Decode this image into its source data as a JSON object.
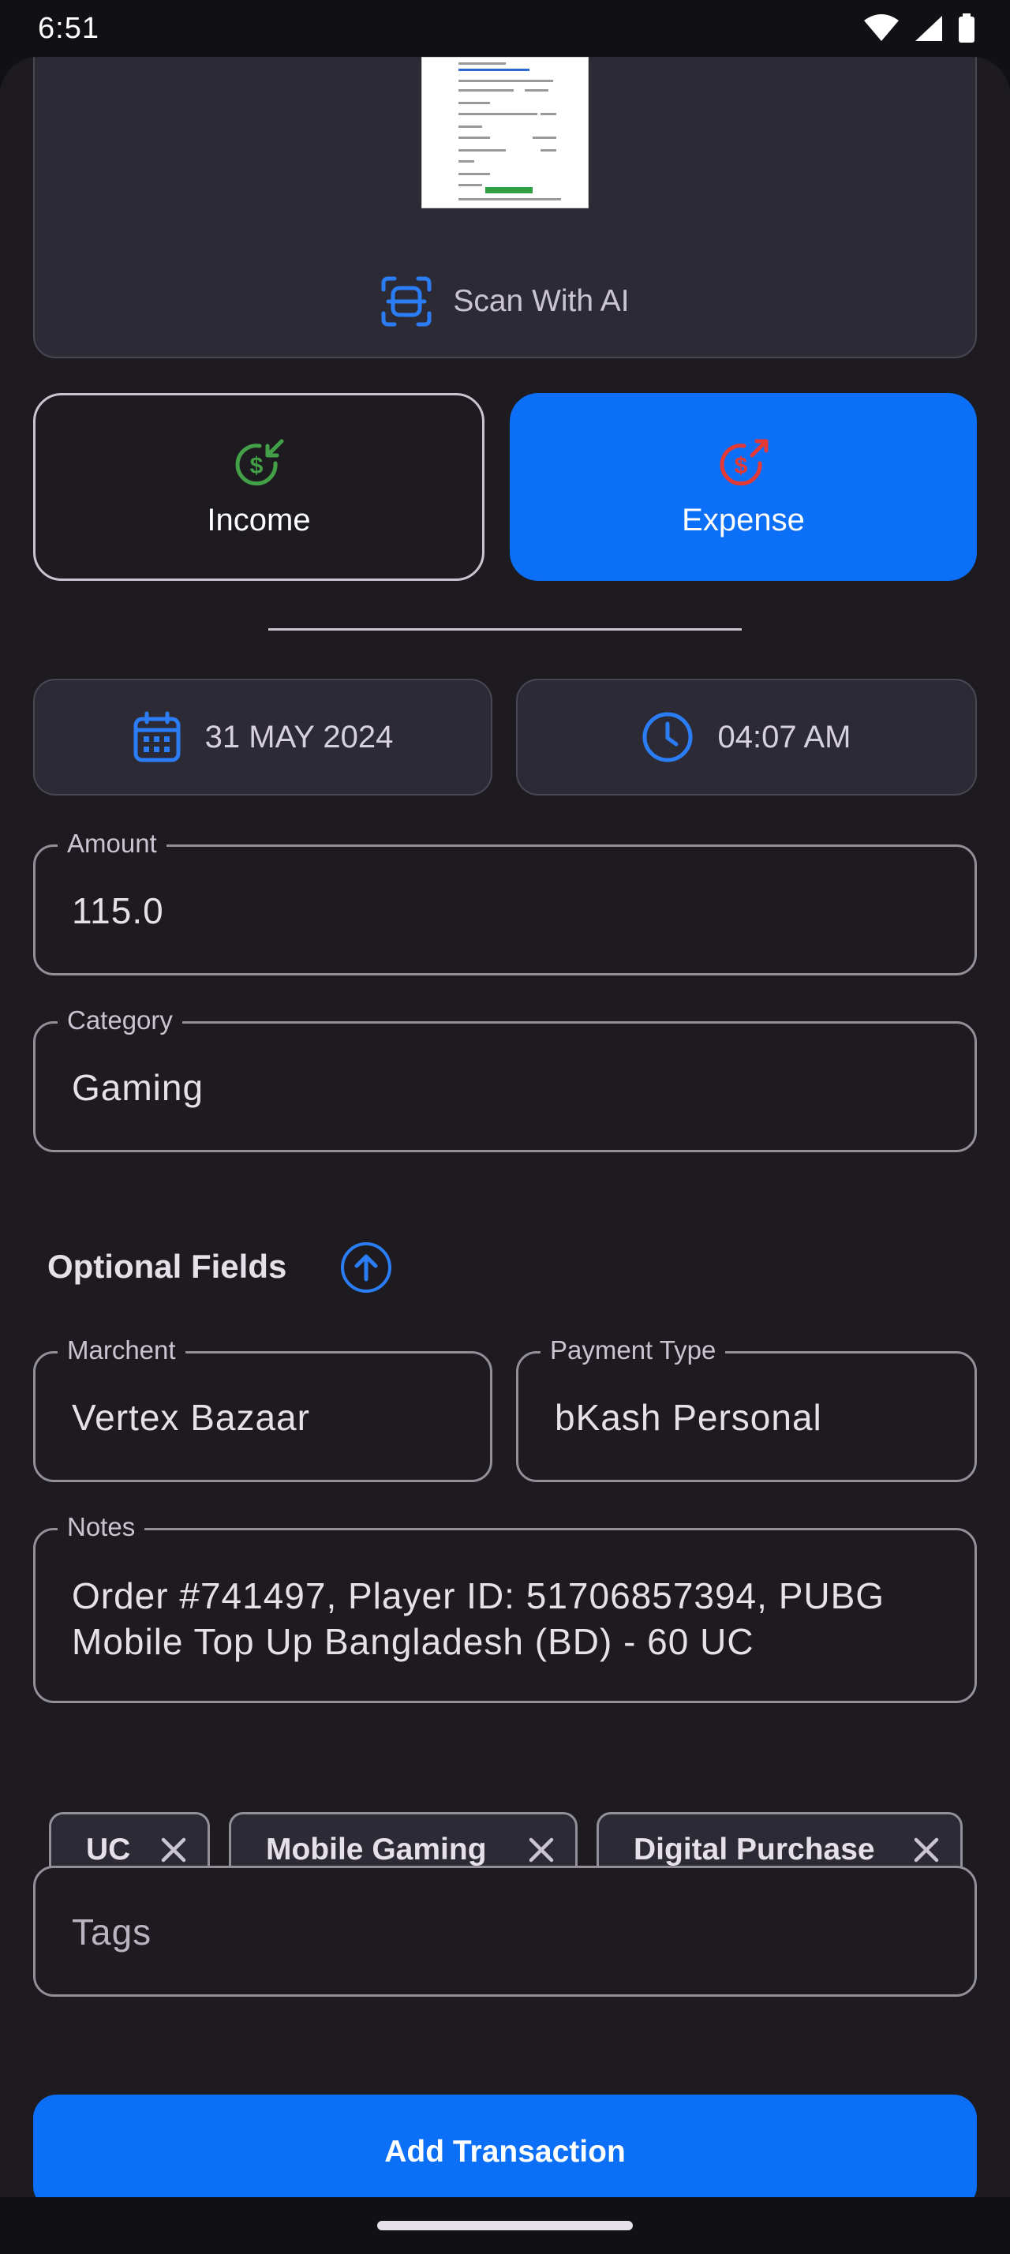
{
  "status_bar": {
    "time": "6:51"
  },
  "scan": {
    "label": "Scan With AI",
    "icon": "document-scanner-icon"
  },
  "type_toggle": {
    "income_label": "Income",
    "expense_label": "Expense",
    "selected": "Expense",
    "income_color": "#43a047",
    "expense_color": "#e53935",
    "accent": "#0c6ff7"
  },
  "date_time": {
    "date": "31 MAY 2024",
    "time": "04:07 AM"
  },
  "amount": {
    "label": "Amount",
    "value": "115.0"
  },
  "category": {
    "label": "Category",
    "value": "Gaming"
  },
  "optional": {
    "title": "Optional Fields"
  },
  "merchant": {
    "label": "Marchent",
    "value": "Vertex Bazaar"
  },
  "payment": {
    "label": "Payment Type",
    "value": "bKash Personal"
  },
  "notes": {
    "label": "Notes",
    "line1": "Order #741497, Player ID: 51706857394, PUBG",
    "line2": "Mobile Top Up Bangladesh (BD) - 60 UC"
  },
  "chips": [
    {
      "label": "UC"
    },
    {
      "label": "Mobile Gaming"
    },
    {
      "label": "Digital Purchase"
    }
  ],
  "tags": {
    "placeholder": "Tags"
  },
  "submit": {
    "label": "Add Transaction"
  }
}
